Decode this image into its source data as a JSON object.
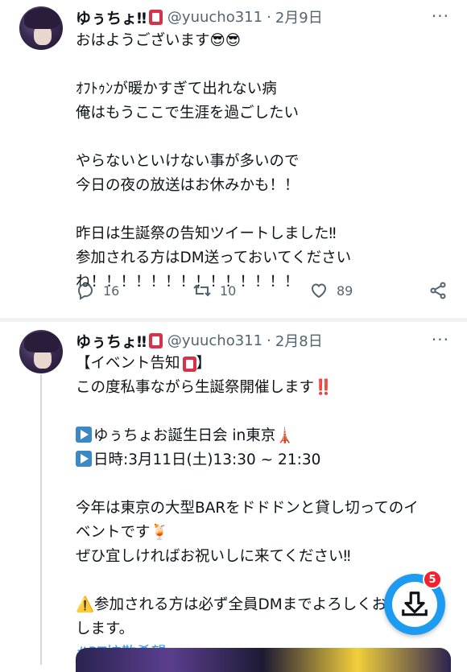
{
  "tweets": [
    {
      "name": "ゆぅちょ‼",
      "handle": "@yuucho311",
      "date": "2月9日",
      "lines": [
        "おはようございます😎😎",
        "",
        "ｵﾌﾄｩﾝが暖かすぎて出れない病",
        "俺はもうここで生涯を過ごしたい",
        "",
        "やらないといけない事が多いので",
        "今日の夜の放送はお休みかも！！",
        "",
        "昨日は生誕祭の告知ツイートしました‼",
        "参加される方はDM送っておいてください",
        "ね！！！！！！！！！！！！！！"
      ],
      "replies": "16",
      "retweets": "10",
      "likes": "89"
    },
    {
      "name": "ゆぅちょ‼",
      "handle": "@yuucho311",
      "date": "2月8日",
      "lines": [
        "【イベント告知",
        "この度私事ながら生誕祭開催します‼️",
        "",
        "ゆぅちょお誕生日会 in東京🗼",
        "日時:3月11日(土)13:30 ~ 21:30",
        "",
        "今年は東京の大型BARをドドドンと貸し切ってのイ",
        "ベントです🍹",
        "ぜひ宜しければお祝いしに来てください‼",
        "",
        "⚠️参加される方は必ず全員DMまでよろしくお願い",
        "します。"
      ],
      "hashtag": "#RT拡散希望"
    }
  ],
  "fab": {
    "badge": "5"
  },
  "colors": {
    "accent": "#1d9bf0",
    "muted": "#536471",
    "badge_red": "#d6334b"
  }
}
